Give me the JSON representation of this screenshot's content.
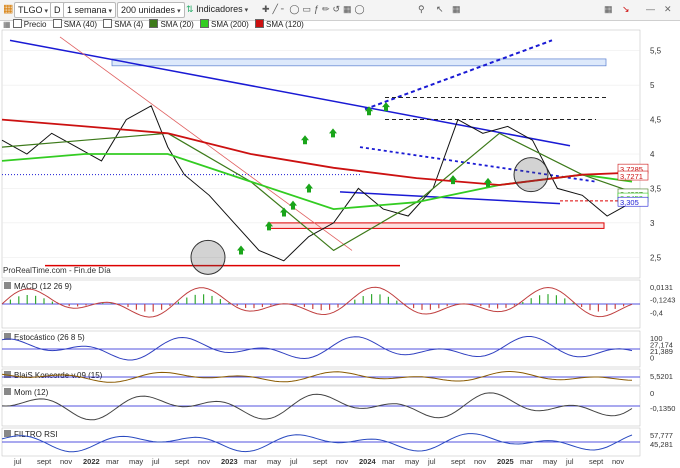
{
  "toolbar": {
    "symbol": "TLGO",
    "d_label": "D",
    "period": "1 semana",
    "units": "200 unidades",
    "indicators": "Indicadores"
  },
  "legend": {
    "price": "Precio",
    "sma40": "SMA (40)",
    "sma4": "SMA (4)",
    "sma20": "SMA (20)",
    "sma200": "SMA (200)",
    "sma120": "SMA (120)"
  },
  "colors": {
    "price": "#000000",
    "sma40": "#1a1a1a",
    "sma4": "#2233cc",
    "sma20": "#3d7a1a",
    "sma200": "#33cc22",
    "sma120": "#cc1111",
    "trend_blue": "#1a1ad4",
    "support_red": "#dd0000"
  },
  "source_label": "ProRealTime.com - Fin.de Día",
  "chart_data": [
    {
      "panel": "price",
      "type": "line",
      "title": "",
      "y_ticks": [
        5.5,
        5,
        4.5,
        4,
        3.5,
        3,
        2.5
      ],
      "y_tick_labels": [
        "5,5",
        "5",
        "4,5",
        "4",
        "3,5",
        "3",
        "2,5"
      ],
      "ylim": [
        2.2,
        5.8
      ],
      "x_ticks": [
        "jul",
        "sept",
        "nov",
        "2022",
        "mar",
        "may",
        "jul",
        "sept",
        "nov",
        "2023",
        "mar",
        "may",
        "jul",
        "sept",
        "nov",
        "2024",
        "mar",
        "may",
        "jul",
        "sept",
        "nov",
        "2025",
        "mar",
        "may",
        "jul",
        "sept",
        "nov"
      ],
      "price_labels": [
        "3,7285",
        "3,7271",
        "3,4237",
        "3,3452",
        "3,305"
      ],
      "series": [
        {
          "name": "Precio",
          "x": [
            0,
            6,
            12,
            18,
            24,
            30,
            36,
            40,
            44,
            50,
            56,
            62,
            68,
            74,
            80,
            86,
            92,
            98,
            104,
            110,
            116,
            122,
            128,
            134,
            140,
            146,
            152
          ],
          "values": [
            4.2,
            4.0,
            4.3,
            4.1,
            3.9,
            4.5,
            4.7,
            4.1,
            3.7,
            3.4,
            3.0,
            2.6,
            2.45,
            2.8,
            3.0,
            3.5,
            3.2,
            3.1,
            3.5,
            4.5,
            4.3,
            4.4,
            4.2,
            3.5,
            3.4,
            3.1,
            3.3
          ]
        },
        {
          "name": "SMA (20)",
          "x": [
            0,
            20,
            40,
            60,
            80,
            100,
            120,
            140,
            152
          ],
          "values": [
            4.1,
            4.2,
            4.3,
            3.6,
            2.6,
            3.3,
            4.3,
            3.7,
            3.45
          ]
        },
        {
          "name": "SMA (200)",
          "x": [
            0,
            20,
            40,
            60,
            80,
            100,
            120,
            140,
            152
          ],
          "values": [
            3.9,
            4.0,
            4.0,
            3.6,
            3.2,
            3.3,
            3.55,
            3.7,
            3.6
          ]
        },
        {
          "name": "SMA (120)",
          "x": [
            0,
            20,
            40,
            60,
            80,
            100,
            120,
            140,
            152
          ],
          "values": [
            4.5,
            4.4,
            4.3,
            4.0,
            3.8,
            3.65,
            3.55,
            3.7,
            3.73
          ]
        }
      ]
    },
    {
      "panel": "macd",
      "type": "line",
      "title": "MACD (12 26 9)",
      "y_tick_labels": [
        "0,0131",
        "-0,1243",
        "-0,4"
      ]
    },
    {
      "panel": "stochastic",
      "type": "line",
      "title": "Estocástico (26 8 5)",
      "y_tick_labels": [
        "100",
        "27,174",
        "21,389",
        "0"
      ]
    },
    {
      "panel": "blaise",
      "type": "area",
      "title": "BlaiS Koncorde v.09 (15)",
      "y_tick_labels": [
        "5,5201"
      ]
    },
    {
      "panel": "momentum",
      "type": "area",
      "title": "Mom (12)",
      "y_tick_labels": [
        "0",
        "-0,1350"
      ]
    },
    {
      "panel": "rsi_filter",
      "type": "area",
      "title": "FILTRO RSI",
      "y_tick_labels": [
        "57,777",
        "45,281"
      ]
    }
  ]
}
